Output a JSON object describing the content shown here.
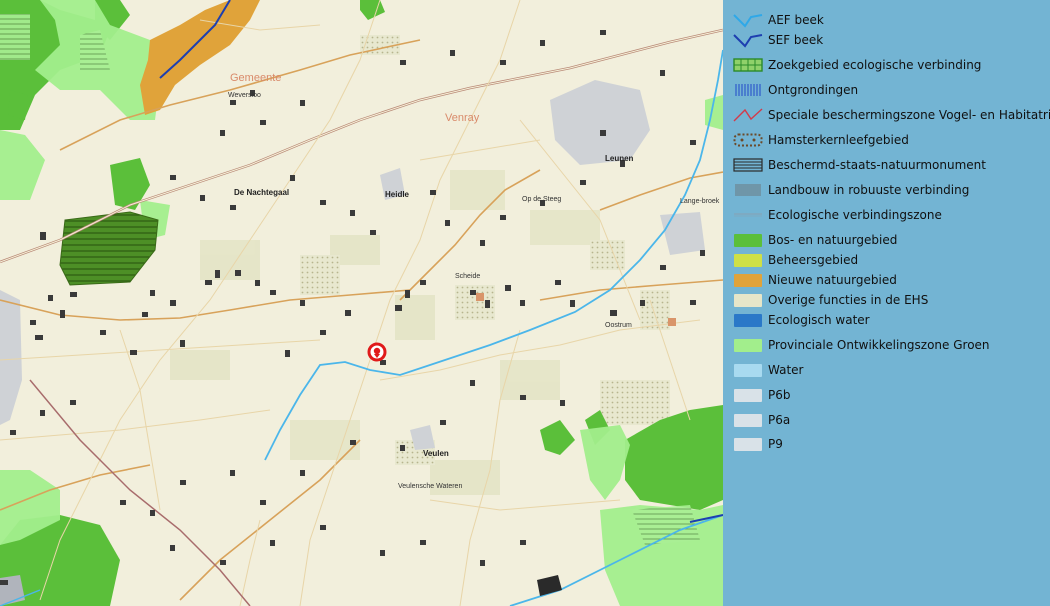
{
  "map": {
    "municipality_labels": [
      "Gemeente",
      "Venray"
    ],
    "place_labels": {
      "de_nachtegaal": "De Nachtegaal",
      "heidle": "Heidle",
      "leunen": "Leunen",
      "scheide": "Scheide",
      "op_de_steeg": "Op de Steeg",
      "veulen": "Veulen",
      "oostrum": "Oostrum",
      "veulensche_wateren": "Veulensche Wateren",
      "weversloo": "Weversloo",
      "lange_broek": "Lange-broek"
    }
  },
  "legend": {
    "items": [
      {
        "label": "AEF beek",
        "icon": "line-light-blue",
        "color": "#2fa8e8"
      },
      {
        "label": "SEF beek",
        "icon": "line-dark-blue",
        "color": "#1d3fb0"
      },
      {
        "label": "Zoekgebied ecologische verbinding",
        "icon": "green-grid",
        "color": "#2a8a2a"
      },
      {
        "label": "Ontgrondingen",
        "icon": "blue-vertical-hatch",
        "color": "#2147c9"
      },
      {
        "label": "Speciale beschermingszone Vogel- en Habitatrich",
        "icon": "line-red",
        "color": "#d33a4a"
      },
      {
        "label": "Hamsterkernleefgebied",
        "icon": "dotted-outline",
        "color": "#6b4a2a"
      },
      {
        "label": "Beschermd-staats-natuurmonument",
        "icon": "horizontal-hatch",
        "color": "#2a2a2a"
      },
      {
        "label": "Landbouw in robuuste verbinding",
        "icon": "grey-vertical-hatch",
        "color": "#6a6a6a"
      },
      {
        "label": "Ecologische verbindingszone",
        "icon": "thin-line",
        "color": "#8aa0b0"
      },
      {
        "label": "Bos- en natuurgebied",
        "icon": "fill",
        "color": "#5bbf3a"
      },
      {
        "label": "Beheersgebied",
        "icon": "fill",
        "color": "#cfe046"
      },
      {
        "label": "Nieuwe natuurgebied",
        "icon": "fill",
        "color": "#e0a33a"
      },
      {
        "label": "Overige functies in de EHS",
        "icon": "fill",
        "color": "#e6e6c9"
      },
      {
        "label": "Ecologisch water",
        "icon": "fill",
        "color": "#2a78c8"
      },
      {
        "label": "Provinciale Ontwikkelingszone Groen",
        "icon": "fill",
        "color": "#a2ee8c"
      },
      {
        "label": "Water",
        "icon": "fill",
        "color": "#a8daf0"
      },
      {
        "label": "P6b",
        "icon": "fill",
        "color": "#d9e2e8"
      },
      {
        "label": "P6a",
        "icon": "fill",
        "color": "#d9e2e8"
      },
      {
        "label": "P9",
        "icon": "fill",
        "color": "#d9e2e8"
      }
    ]
  }
}
